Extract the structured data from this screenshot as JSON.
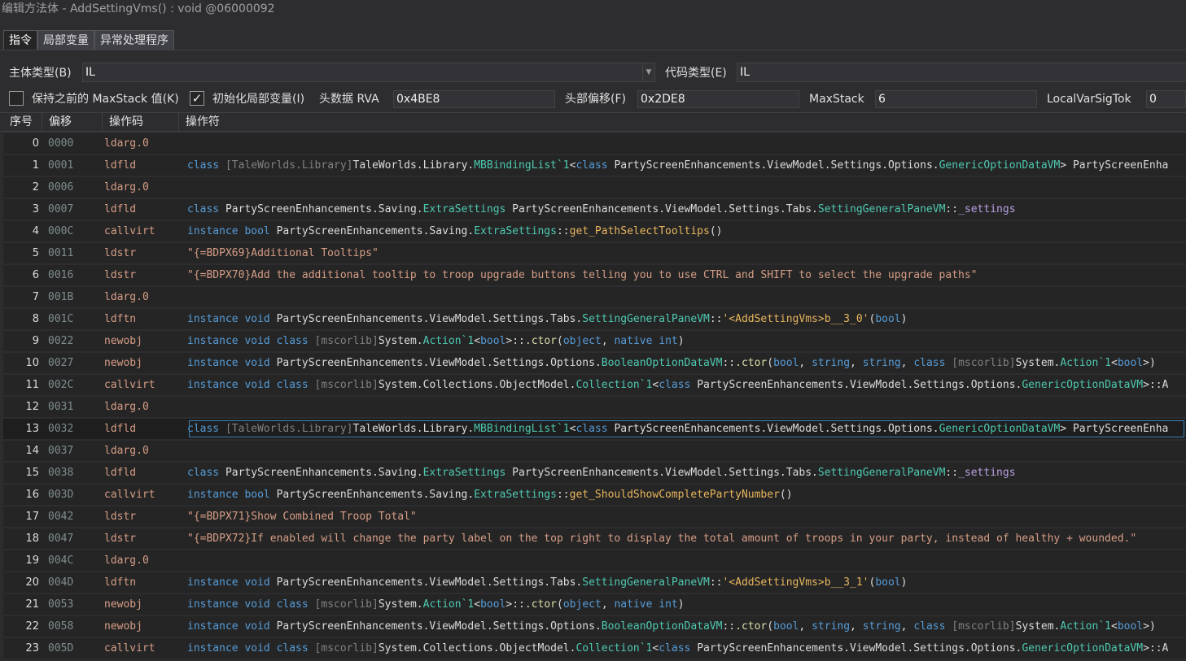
{
  "window": {
    "title": "编辑方法体 - AddSettingVms() : void @06000092"
  },
  "tabs": [
    {
      "label": "指令",
      "active": true
    },
    {
      "label": "局部变量",
      "active": false
    },
    {
      "label": "异常处理程序",
      "active": false
    }
  ],
  "form": {
    "body_type_label": "主体类型(B)",
    "body_type_value": "IL",
    "code_type_label": "代码类型(E)",
    "code_type_value": "IL",
    "keep_maxstack_label": "保持之前的 MaxStack 值(K)",
    "keep_maxstack_checked": false,
    "init_locals_label": "初始化局部变量(I)",
    "init_locals_checked": true,
    "header_rva_label": "头数据 RVA",
    "header_rva_value": "0x4BE8",
    "header_offset_label": "头部偏移(F)",
    "header_offset_value": "0x2DE8",
    "maxstack_label": "MaxStack",
    "maxstack_value": "6",
    "localvarsigtok_label": "LocalVarSigTok",
    "localvarsigtok_value": "0"
  },
  "grid": {
    "columns": [
      "序号",
      "偏移",
      "操作码",
      "操作符"
    ],
    "selected_index": 13,
    "rows": [
      {
        "index": "0",
        "offset": "0000",
        "opcode": "ldarg.0",
        "operand": []
      },
      {
        "index": "1",
        "offset": "0001",
        "opcode": "ldfld",
        "operand": [
          [
            "kw",
            "class "
          ],
          [
            "asm",
            "[TaleWorlds.Library]"
          ],
          [
            "ns",
            "TaleWorlds.Library."
          ],
          [
            "tp",
            "MBBindingList`1"
          ],
          [
            "pn",
            "<"
          ],
          [
            "kw",
            "class "
          ],
          [
            "ns",
            "PartyScreenEnhancements.ViewModel.Settings.Options."
          ],
          [
            "tp",
            "GenericOptionDataVM"
          ],
          [
            "pn",
            "> PartyScreenEnha"
          ]
        ]
      },
      {
        "index": "2",
        "offset": "0006",
        "opcode": "ldarg.0",
        "operand": []
      },
      {
        "index": "3",
        "offset": "0007",
        "opcode": "ldfld",
        "operand": [
          [
            "kw",
            "class "
          ],
          [
            "ns",
            "PartyScreenEnhancements.Saving."
          ],
          [
            "tp",
            "ExtraSettings"
          ],
          [
            "ns",
            " PartyScreenEnhancements.ViewModel.Settings.Tabs."
          ],
          [
            "tp",
            "SettingGeneralPaneVM"
          ],
          [
            "pn",
            "::"
          ],
          [
            "fld",
            "_settings"
          ]
        ]
      },
      {
        "index": "4",
        "offset": "000C",
        "opcode": "callvirt",
        "operand": [
          [
            "kw",
            "instance bool "
          ],
          [
            "ns",
            "PartyScreenEnhancements.Saving."
          ],
          [
            "tp",
            "ExtraSettings"
          ],
          [
            "pn",
            "::"
          ],
          [
            "mv",
            "get_PathSelectTooltips"
          ],
          [
            "pn",
            "()"
          ]
        ]
      },
      {
        "index": "5",
        "offset": "0011",
        "opcode": "ldstr",
        "operand": [
          [
            "str",
            "\"{=BDPX69}Additional Tooltips\""
          ]
        ]
      },
      {
        "index": "6",
        "offset": "0016",
        "opcode": "ldstr",
        "operand": [
          [
            "str",
            "\"{=BDPX70}Add the additional tooltip to troop upgrade buttons telling you to use CTRL and SHIFT to select the upgrade paths\""
          ]
        ]
      },
      {
        "index": "7",
        "offset": "001B",
        "opcode": "ldarg.0",
        "operand": []
      },
      {
        "index": "8",
        "offset": "001C",
        "opcode": "ldftn",
        "operand": [
          [
            "kw",
            "instance void "
          ],
          [
            "ns",
            "PartyScreenEnhancements.ViewModel.Settings.Tabs."
          ],
          [
            "tp",
            "SettingGeneralPaneVM"
          ],
          [
            "pn",
            "::"
          ],
          [
            "mv",
            "'<AddSettingVms>b__3_0'"
          ],
          [
            "pn",
            "("
          ],
          [
            "kw",
            "bool"
          ],
          [
            "pn",
            ")"
          ]
        ]
      },
      {
        "index": "9",
        "offset": "0022",
        "opcode": "newobj",
        "operand": [
          [
            "kw",
            "instance void class "
          ],
          [
            "asm",
            "[mscorlib]"
          ],
          [
            "ns",
            "System."
          ],
          [
            "tp",
            "Action`1"
          ],
          [
            "pn",
            "<"
          ],
          [
            "kw",
            "bool"
          ],
          [
            "pn",
            ">::"
          ],
          [
            "mth",
            ".ctor"
          ],
          [
            "pn",
            "("
          ],
          [
            "kw",
            "object"
          ],
          [
            "pn",
            ", "
          ],
          [
            "kw",
            "native int"
          ],
          [
            "pn",
            ")"
          ]
        ]
      },
      {
        "index": "10",
        "offset": "0027",
        "opcode": "newobj",
        "operand": [
          [
            "kw",
            "instance void "
          ],
          [
            "ns",
            "PartyScreenEnhancements.ViewModel.Settings.Options."
          ],
          [
            "tp",
            "BooleanOptionDataVM"
          ],
          [
            "pn",
            "::"
          ],
          [
            "mth",
            ".ctor"
          ],
          [
            "pn",
            "("
          ],
          [
            "kw",
            "bool"
          ],
          [
            "pn",
            ", "
          ],
          [
            "kw",
            "string"
          ],
          [
            "pn",
            ", "
          ],
          [
            "kw",
            "string"
          ],
          [
            "pn",
            ", "
          ],
          [
            "kw",
            "class "
          ],
          [
            "asm",
            "[mscorlib]"
          ],
          [
            "ns",
            "System."
          ],
          [
            "tp",
            "Action`1"
          ],
          [
            "pn",
            "<"
          ],
          [
            "kw",
            "bool"
          ],
          [
            "pn",
            ">)"
          ]
        ]
      },
      {
        "index": "11",
        "offset": "002C",
        "opcode": "callvirt",
        "operand": [
          [
            "kw",
            "instance void class "
          ],
          [
            "asm",
            "[mscorlib]"
          ],
          [
            "ns",
            "System.Collections.ObjectModel."
          ],
          [
            "tp",
            "Collection`1"
          ],
          [
            "pn",
            "<"
          ],
          [
            "kw",
            "class "
          ],
          [
            "ns",
            "PartyScreenEnhancements.ViewModel.Settings.Options."
          ],
          [
            "tp",
            "GenericOptionDataVM"
          ],
          [
            "pn",
            ">::A"
          ]
        ]
      },
      {
        "index": "12",
        "offset": "0031",
        "opcode": "ldarg.0",
        "operand": []
      },
      {
        "index": "13",
        "offset": "0032",
        "opcode": "ldfld",
        "operand": [
          [
            "kw",
            "class "
          ],
          [
            "asm",
            "[TaleWorlds.Library]"
          ],
          [
            "ns",
            "TaleWorlds.Library."
          ],
          [
            "tp",
            "MBBindingList`1"
          ],
          [
            "pn",
            "<"
          ],
          [
            "kw",
            "class "
          ],
          [
            "ns",
            "PartyScreenEnhancements.ViewModel.Settings.Options."
          ],
          [
            "tp",
            "GenericOptionDataVM"
          ],
          [
            "pn",
            "> PartyScreenEnha"
          ]
        ]
      },
      {
        "index": "14",
        "offset": "0037",
        "opcode": "ldarg.0",
        "operand": []
      },
      {
        "index": "15",
        "offset": "0038",
        "opcode": "ldfld",
        "operand": [
          [
            "kw",
            "class "
          ],
          [
            "ns",
            "PartyScreenEnhancements.Saving."
          ],
          [
            "tp",
            "ExtraSettings"
          ],
          [
            "ns",
            " PartyScreenEnhancements.ViewModel.Settings.Tabs."
          ],
          [
            "tp",
            "SettingGeneralPaneVM"
          ],
          [
            "pn",
            "::"
          ],
          [
            "fld",
            "_settings"
          ]
        ]
      },
      {
        "index": "16",
        "offset": "003D",
        "opcode": "callvirt",
        "operand": [
          [
            "kw",
            "instance bool "
          ],
          [
            "ns",
            "PartyScreenEnhancements.Saving."
          ],
          [
            "tp",
            "ExtraSettings"
          ],
          [
            "pn",
            "::"
          ],
          [
            "mv",
            "get_ShouldShowCompletePartyNumber"
          ],
          [
            "pn",
            "()"
          ]
        ]
      },
      {
        "index": "17",
        "offset": "0042",
        "opcode": "ldstr",
        "operand": [
          [
            "str",
            "\"{=BDPX71}Show Combined Troop Total\""
          ]
        ]
      },
      {
        "index": "18",
        "offset": "0047",
        "opcode": "ldstr",
        "operand": [
          [
            "str",
            "\"{=BDPX72}If enabled will change the party label on the top right to display the total amount of troops in your party, instead of healthy + wounded.\""
          ]
        ]
      },
      {
        "index": "19",
        "offset": "004C",
        "opcode": "ldarg.0",
        "operand": []
      },
      {
        "index": "20",
        "offset": "004D",
        "opcode": "ldftn",
        "operand": [
          [
            "kw",
            "instance void "
          ],
          [
            "ns",
            "PartyScreenEnhancements.ViewModel.Settings.Tabs."
          ],
          [
            "tp",
            "SettingGeneralPaneVM"
          ],
          [
            "pn",
            "::"
          ],
          [
            "mv",
            "'<AddSettingVms>b__3_1'"
          ],
          [
            "pn",
            "("
          ],
          [
            "kw",
            "bool"
          ],
          [
            "pn",
            ")"
          ]
        ]
      },
      {
        "index": "21",
        "offset": "0053",
        "opcode": "newobj",
        "operand": [
          [
            "kw",
            "instance void class "
          ],
          [
            "asm",
            "[mscorlib]"
          ],
          [
            "ns",
            "System."
          ],
          [
            "tp",
            "Action`1"
          ],
          [
            "pn",
            "<"
          ],
          [
            "kw",
            "bool"
          ],
          [
            "pn",
            ">::"
          ],
          [
            "mth",
            ".ctor"
          ],
          [
            "pn",
            "("
          ],
          [
            "kw",
            "object"
          ],
          [
            "pn",
            ", "
          ],
          [
            "kw",
            "native int"
          ],
          [
            "pn",
            ")"
          ]
        ]
      },
      {
        "index": "22",
        "offset": "0058",
        "opcode": "newobj",
        "operand": [
          [
            "kw",
            "instance void "
          ],
          [
            "ns",
            "PartyScreenEnhancements.ViewModel.Settings.Options."
          ],
          [
            "tp",
            "BooleanOptionDataVM"
          ],
          [
            "pn",
            "::"
          ],
          [
            "mth",
            ".ctor"
          ],
          [
            "pn",
            "("
          ],
          [
            "kw",
            "bool"
          ],
          [
            "pn",
            ", "
          ],
          [
            "kw",
            "string"
          ],
          [
            "pn",
            ", "
          ],
          [
            "kw",
            "string"
          ],
          [
            "pn",
            ", "
          ],
          [
            "kw",
            "class "
          ],
          [
            "asm",
            "[mscorlib]"
          ],
          [
            "ns",
            "System."
          ],
          [
            "tp",
            "Action`1"
          ],
          [
            "pn",
            "<"
          ],
          [
            "kw",
            "bool"
          ],
          [
            "pn",
            ">)"
          ]
        ]
      },
      {
        "index": "23",
        "offset": "005D",
        "opcode": "callvirt",
        "operand": [
          [
            "kw",
            "instance void class "
          ],
          [
            "asm",
            "[mscorlib]"
          ],
          [
            "ns",
            "System.Collections.ObjectModel."
          ],
          [
            "tp",
            "Collection`1"
          ],
          [
            "pn",
            "<"
          ],
          [
            "kw",
            "class "
          ],
          [
            "ns",
            "PartyScreenEnhancements.ViewModel.Settings.Options."
          ],
          [
            "tp",
            "GenericOptionDataVM"
          ],
          [
            "pn",
            ">::A"
          ]
        ]
      }
    ]
  }
}
